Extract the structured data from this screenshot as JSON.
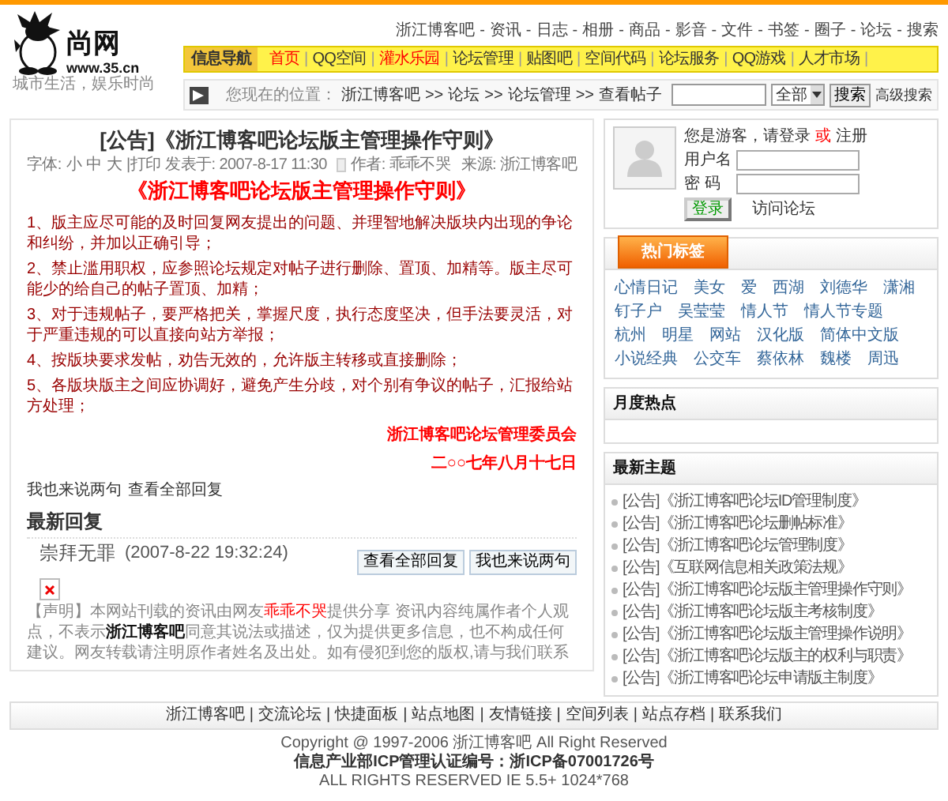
{
  "logo": {
    "name": "尚网",
    "url": "www.35.cn",
    "slogan": "城市生活，娱乐时尚"
  },
  "top_links": {
    "separator": "-",
    "items": [
      "浙江博客吧",
      "资讯",
      "日志",
      "相册",
      "商品",
      "影音",
      "文件",
      "书签",
      "圈子",
      "论坛",
      "搜索"
    ]
  },
  "nav": {
    "label": "信息导航",
    "separator": "|",
    "items": [
      {
        "label": "首页",
        "color": "#ff0000"
      },
      {
        "label": "QQ空间",
        "color": "#333333"
      },
      {
        "label": "灌水乐园",
        "color": "#ff0000"
      },
      {
        "label": "论坛管理",
        "color": "#333333"
      },
      {
        "label": "贴图吧",
        "color": "#333333"
      },
      {
        "label": "空间代码",
        "color": "#333333"
      },
      {
        "label": "论坛服务",
        "color": "#333333"
      },
      {
        "label": "QQ游戏",
        "color": "#333333"
      },
      {
        "label": "人才市场",
        "color": "#333333"
      }
    ]
  },
  "breadcrumb": {
    "prefix": "您现在的位置：",
    "separator": ">>",
    "items": [
      "浙江博客吧",
      "论坛",
      "论坛管理",
      "查看帖子"
    ]
  },
  "search": {
    "scope": "全部",
    "button": "搜索",
    "advanced": "高级搜索"
  },
  "post": {
    "title": "[公告]《浙江博客吧论坛版主管理操作守则》",
    "meta": {
      "font_label": "字体:",
      "sizes": [
        "小",
        "中",
        "大"
      ],
      "print": "|打印",
      "posted": "发表于: 2007-8-17 11:30",
      "author": "作者: 乖乖不哭",
      "source": "来源: 浙江博客吧"
    },
    "heading": "《浙江博客吧论坛版主管理操作守则》",
    "rules": [
      "1、版主应尽可能的及时回复网友提出的问题、并理智地解决版块内出现的争论和纠纷，并加以正确引导；",
      "2、禁止滥用职权，应参照论坛规定对帖子进行删除、置顶、加精等。版主尽可能少的给自己的帖子置顶、加精；",
      "3、对于违规帖子，要严格把关，掌握尺度，执行态度坚决，但手法要灵活，对于严重违规的可以直接向站方举报；",
      "4、按版块要求发帖，劝告无效的，允许版主转移或直接删除；",
      "5、各版块版主之间应协调好，避免产生分歧，对个别有争议的帖子，汇报给站方处理；"
    ],
    "signature": "浙江博客吧论坛管理委员会",
    "date": "二○○七年八月十七日",
    "actions": [
      "我也来说两句",
      "查看全部回复"
    ]
  },
  "replies": {
    "heading": "最新回复",
    "author": "崇拜无罪",
    "time": "(2007-8-22 19:32:24)",
    "buttons": [
      "查看全部回复",
      "我也来说两句"
    ]
  },
  "disclaimer": [
    {
      "kind": "plain",
      "text": "【声明】本网站刊载的资讯由网友"
    },
    {
      "kind": "user",
      "text": "乖乖不哭"
    },
    {
      "kind": "plain",
      "text": "提供分享 资讯内容纯属作者个人观点，不表示"
    },
    {
      "kind": "site",
      "text": "浙江博客吧"
    },
    {
      "kind": "plain",
      "text": "同意其说法或描述，仅为提供更多信息，也不构成任何建议。网友转载请注明原作者姓名及出处。如有侵犯到您的版权,请与我们联系"
    }
  ],
  "login": {
    "greeting": "您是游客，请登录",
    "or": "或",
    "register": "注册",
    "username_label": "用户名",
    "password_label": "密 码",
    "button": "登录",
    "visit": "访问论坛"
  },
  "hot_tags": {
    "title": "热门标签",
    "tags": [
      "心情日记",
      "美女",
      "爱",
      "西湖",
      "刘德华",
      "潇湘",
      "钉子户",
      "吴莹莹",
      "情人节",
      "情人节专题",
      "杭州",
      "明星",
      "网站",
      "汉化版",
      "简体中文版",
      "小说经典",
      "公交车",
      "蔡依林",
      "魏楼",
      "周迅"
    ]
  },
  "monthly_hot": {
    "title": "月度热点"
  },
  "latest_topics": {
    "title": "最新主题",
    "items": [
      "[公告]《浙江博客吧论坛ID管理制度》",
      "[公告]《浙江博客吧论坛删帖标准》",
      "[公告]《浙江博客吧论坛管理制度》",
      "[公告]《互联网信息相关政策法规》",
      "[公告]《浙江博客吧论坛版主管理操作守则》",
      "[公告]《浙江博客吧论坛版主考核制度》",
      "[公告]《浙江博客吧论坛版主管理操作说明》",
      "[公告]《浙江博客吧论坛版主的权利与职责》",
      "[公告]《浙江博客吧论坛申请版主制度》"
    ]
  },
  "footer": {
    "separator": "|",
    "links": [
      "浙江博客吧",
      "交流论坛",
      "快捷面板",
      "站点地图",
      "友情链接",
      "空间列表",
      "站点存档",
      "联系我们"
    ],
    "copyright": "Copyright @ 1997-2006 浙江博客吧  All Right Reserved",
    "icp": "信息产业部ICP管理认证编号：浙ICP备07001726号",
    "rights": "ALL RIGHTS RESERVED IE 5.5+ 1024*768"
  }
}
